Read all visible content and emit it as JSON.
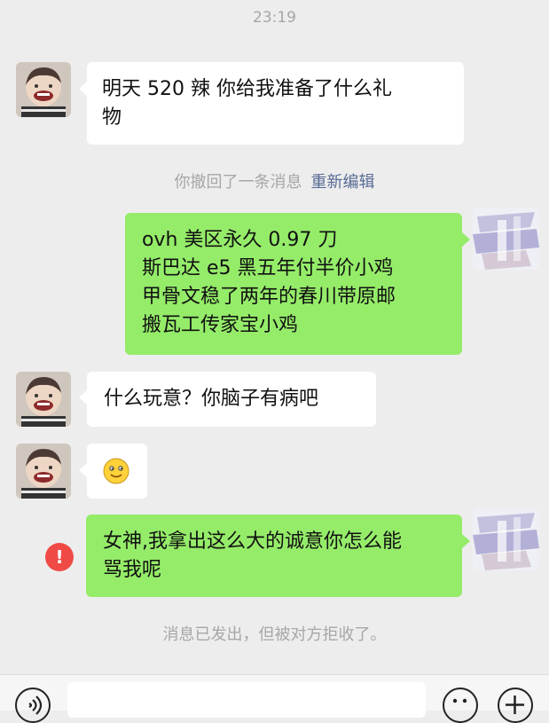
{
  "chat": {
    "timestamp": "23:19",
    "messages": [
      {
        "side": "left",
        "lines": [
          "明天 520 辣 你给我准备了什么礼",
          "物"
        ]
      },
      {
        "side": "right",
        "lines": [
          "ovh 美区永久 0.97 刀",
          "斯巴达 e5 黑五年付半价小鸡",
          "甲骨文稳了两年的春川带原邮",
          "搬瓦工传家宝小鸡"
        ]
      },
      {
        "side": "left",
        "lines": [
          "什么玩意？你脑子有病吧"
        ]
      },
      {
        "side": "left",
        "emoji": "smile-emoji"
      },
      {
        "side": "right",
        "failed": true,
        "lines": [
          "女神,我拿出这么大的诚意你怎么能",
          "骂我呢"
        ]
      }
    ],
    "system": {
      "recalled": "你撤回了一条消息",
      "reedit": "重新编辑",
      "rejected": "消息已发出，但被对方拒收了。"
    }
  },
  "colors": {
    "background": "#ededed",
    "bubble_white": "#ffffff",
    "bubble_green": "#95ec69",
    "link": "#576b95",
    "error": "#f04a46"
  },
  "icons": {
    "error": "!",
    "voice": "voice-icon",
    "emoji": "emoji-icon",
    "plus": "plus-icon"
  }
}
